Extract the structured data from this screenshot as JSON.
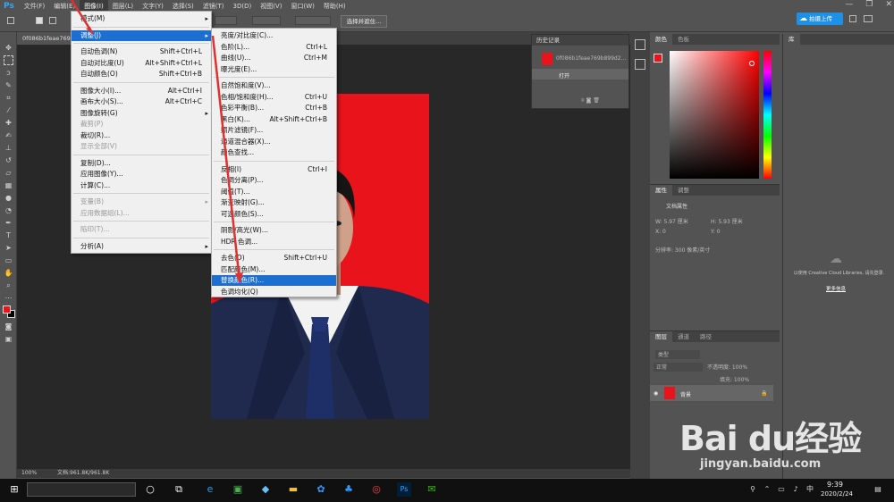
{
  "app": {
    "logo": "Ps"
  },
  "menubar": [
    {
      "label": "文件(F)"
    },
    {
      "label": "编辑(E)"
    },
    {
      "label": "图像(I)"
    },
    {
      "label": "图层(L)"
    },
    {
      "label": "文字(Y)"
    },
    {
      "label": "选择(S)"
    },
    {
      "label": "滤镜(T)"
    },
    {
      "label": "3D(D)"
    },
    {
      "label": "视图(V)"
    },
    {
      "label": "窗口(W)"
    },
    {
      "label": "帮助(H)"
    }
  ],
  "window_controls": {
    "minimize": "—",
    "restore": "❐",
    "close": "✕"
  },
  "options_bar": {
    "select_mask_button": "选择并遮住...",
    "cloud_button": "拍摄上传"
  },
  "document": {
    "tab_title": "0f086b1feae769b...",
    "status_zoom": "100%",
    "status_doc": "文档:961.8K/961.8K"
  },
  "image_menu": {
    "groups": [
      [
        {
          "label": "模式(M)",
          "sub": true
        }
      ],
      [
        {
          "label": "调整(J)",
          "sub": true,
          "highlight": true
        }
      ],
      [
        {
          "label": "自动色调(N)",
          "shortcut": "Shift+Ctrl+L"
        },
        {
          "label": "自动对比度(U)",
          "shortcut": "Alt+Shift+Ctrl+L"
        },
        {
          "label": "自动颜色(O)",
          "shortcut": "Shift+Ctrl+B"
        }
      ],
      [
        {
          "label": "图像大小(I)...",
          "shortcut": "Alt+Ctrl+I"
        },
        {
          "label": "画布大小(S)...",
          "shortcut": "Alt+Ctrl+C"
        },
        {
          "label": "图像旋转(G)",
          "sub": true
        },
        {
          "label": "裁剪(P)",
          "disabled": true
        },
        {
          "label": "裁切(R)..."
        },
        {
          "label": "显示全部(V)",
          "disabled": true
        }
      ],
      [
        {
          "label": "复制(D)..."
        },
        {
          "label": "应用图像(Y)..."
        },
        {
          "label": "计算(C)..."
        }
      ],
      [
        {
          "label": "变量(B)",
          "sub": true,
          "disabled": true
        },
        {
          "label": "应用数据组(L)...",
          "disabled": true
        }
      ],
      [
        {
          "label": "陷印(T)...",
          "disabled": true
        }
      ],
      [
        {
          "label": "分析(A)",
          "sub": true
        }
      ]
    ]
  },
  "adjust_menu": {
    "groups": [
      [
        {
          "label": "亮度/对比度(C)..."
        },
        {
          "label": "色阶(L)...",
          "shortcut": "Ctrl+L"
        },
        {
          "label": "曲线(U)...",
          "shortcut": "Ctrl+M"
        },
        {
          "label": "曝光度(E)..."
        }
      ],
      [
        {
          "label": "自然饱和度(V)..."
        },
        {
          "label": "色相/饱和度(H)...",
          "shortcut": "Ctrl+U"
        },
        {
          "label": "色彩平衡(B)...",
          "shortcut": "Ctrl+B"
        },
        {
          "label": "黑白(K)...",
          "shortcut": "Alt+Shift+Ctrl+B"
        },
        {
          "label": "照片滤镜(F)..."
        },
        {
          "label": "通道混合器(X)..."
        },
        {
          "label": "颜色查找..."
        }
      ],
      [
        {
          "label": "反相(I)",
          "shortcut": "Ctrl+I"
        },
        {
          "label": "色调分离(P)..."
        },
        {
          "label": "阈值(T)..."
        },
        {
          "label": "渐变映射(G)..."
        },
        {
          "label": "可选颜色(S)..."
        }
      ],
      [
        {
          "label": "阴影/高光(W)..."
        },
        {
          "label": "HDR 色调..."
        }
      ],
      [
        {
          "label": "去色(D)",
          "shortcut": "Shift+Ctrl+U"
        },
        {
          "label": "匹配颜色(M)..."
        },
        {
          "label": "替换颜色(R)...",
          "highlight": true
        },
        {
          "label": "色调均化(Q)"
        }
      ]
    ]
  },
  "history_panel": {
    "tab": "历史记录",
    "snapshot": "0f086b1feae769b899d2...",
    "state": "打开"
  },
  "color_panel": {
    "tabs": [
      "颜色",
      "色板"
    ],
    "foreground": "#e8131b",
    "background": "#000000"
  },
  "properties_panel": {
    "tabs": [
      "属性",
      "调整"
    ],
    "header": "文档属性",
    "w": "W: 5.97 厘米",
    "h": "H: 5.93 厘米",
    "x": "X: 0",
    "y": "Y: 0",
    "resolution": "分辨率: 300 像素/英寸"
  },
  "layers_panel": {
    "tabs": [
      "图层",
      "通道",
      "路径"
    ],
    "filter": "类型",
    "blend": "正常",
    "opacity": "不透明度: 100%",
    "fill": "填充: 100%",
    "layer_name": "背景"
  },
  "library_panel": {
    "tab": "库",
    "message": "以使用 Creative Cloud Libraries, 请先登录.",
    "link": "更多信息"
  },
  "taskbar": {
    "time": "9:39",
    "date": "2020/2/24",
    "ime": "中"
  },
  "watermark": {
    "logo": "Bai du经验",
    "url": "jingyan.baidu.com"
  }
}
